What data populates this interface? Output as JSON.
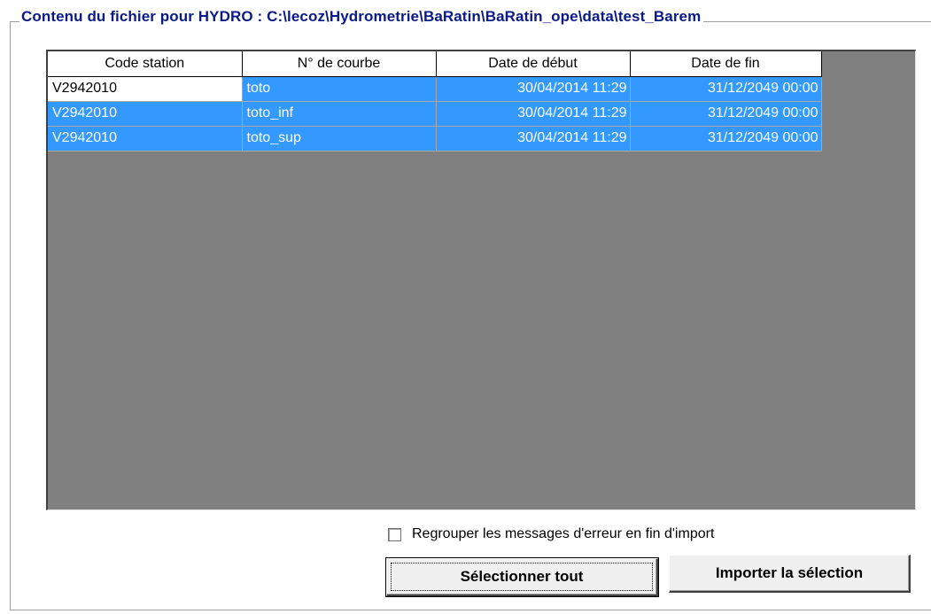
{
  "group_title": "Contenu du fichier pour HYDRO : C:\\lecoz\\Hydrometrie\\BaRatin\\BaRatin_ope\\data\\test_Barem",
  "table": {
    "headers": [
      "Code station",
      "N° de courbe",
      "Date de début",
      "Date de fin"
    ],
    "rows": [
      [
        "V2942010",
        "toto",
        "30/04/2014 11:29",
        "31/12/2049 00:00"
      ],
      [
        "V2942010",
        "toto_inf",
        "30/04/2014 11:29",
        "31/12/2049 00:00"
      ],
      [
        "V2942010",
        "toto_sup",
        "30/04/2014 11:29",
        "31/12/2049 00:00"
      ]
    ]
  },
  "checkbox": {
    "label": "Regrouper les messages d'erreur en fin d'import",
    "checked": false
  },
  "buttons": {
    "select_all": "Sélectionner tout",
    "import_selection": "Importer la sélection"
  },
  "colors": {
    "selection": "#3399ff",
    "grid_background": "#808080",
    "title": "#0a1a8a"
  }
}
